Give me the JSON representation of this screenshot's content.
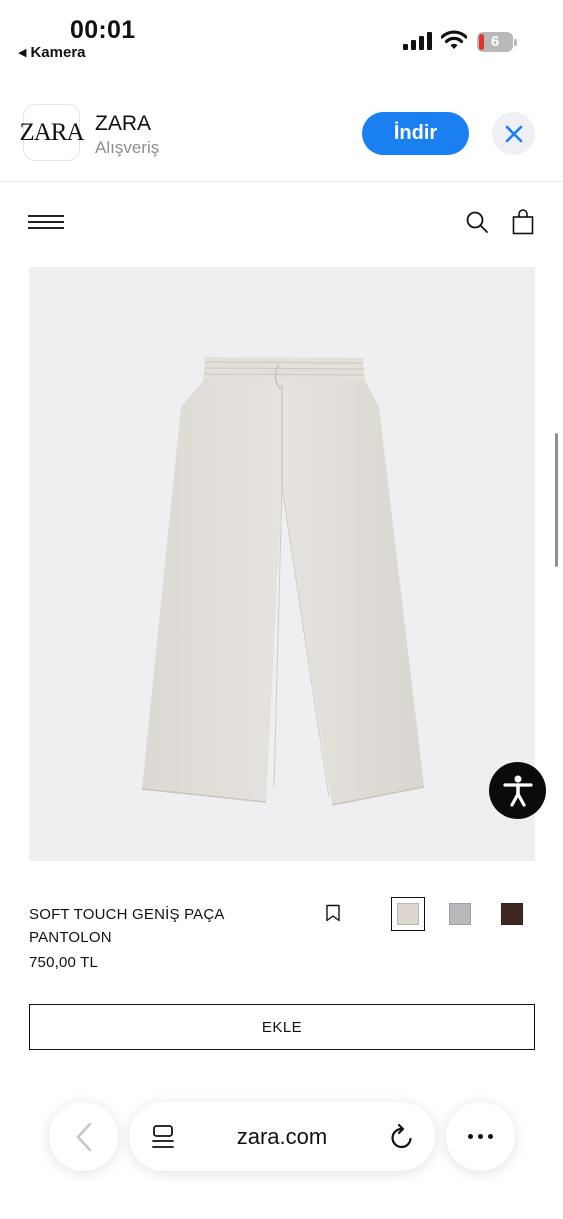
{
  "status_bar": {
    "time": "00:01",
    "back_app": "Kamera",
    "battery_level": "6"
  },
  "app_banner": {
    "icon_text": "ZARA",
    "name": "ZARA",
    "category": "Alışveriş",
    "install_label": "İndir"
  },
  "product": {
    "name": "SOFT TOUCH GENİŞ PAÇA PANTOLON",
    "price": "750,00 TL",
    "add_label": "EKLE",
    "colors": [
      {
        "hex": "#dcd8cf",
        "selected": true
      },
      {
        "hex": "#b8b9bd",
        "selected": false
      },
      {
        "hex": "#3f2721",
        "selected": false
      }
    ]
  },
  "browser": {
    "url": "zara.com"
  }
}
